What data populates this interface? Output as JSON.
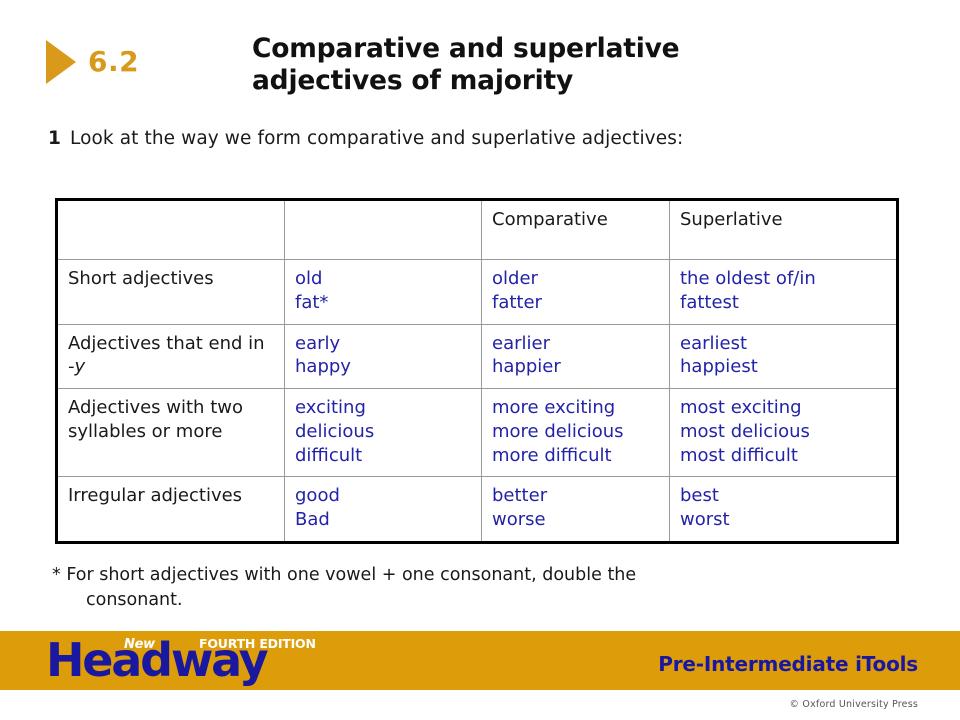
{
  "header": {
    "unit_number": "6.2",
    "title_line1": "Comparative and superlative",
    "title_line2": "adjectives of majority",
    "accent_color": "#D99A1C"
  },
  "instruction": {
    "number": "1",
    "text": "Look at the way we form comparative and superlative adjectives:"
  },
  "table": {
    "headers": [
      "",
      "",
      "Comparative",
      "Superlative"
    ],
    "rows": [
      {
        "category": "Short adjectives",
        "base": "old\nfat*",
        "comparative": "older\nfatter",
        "superlative": "the oldest of/in\nfattest"
      },
      {
        "category_pre": "Adjectives that end in ",
        "category_italic": "-y",
        "category": "Adjectives that end in -y",
        "base": "early\nhappy",
        "comparative": "earlier\nhappier",
        "superlative": "earliest\nhappiest"
      },
      {
        "category": "Adjectives with two syllables or more",
        "base": "exciting\ndelicious\ndifficult",
        "comparative": "more exciting\nmore delicious\nmore difficult",
        "superlative": "most exciting\nmost delicious\nmost difficult"
      },
      {
        "category": "Irregular adjectives",
        "base": "good\nBad",
        "comparative": "better\nworse",
        "superlative": "best\nworst"
      }
    ],
    "text_color": "#2323A8",
    "border_color": "#000000"
  },
  "footnote": {
    "line1": "* For short adjectives with one vowel + one consonant, double the",
    "line2": "consonant."
  },
  "footer": {
    "band_color": "#DD9D0B",
    "logo_new": "New",
    "logo_edition": "FOURTH EDITION",
    "logo_headway": "Headway",
    "product": "Pre-Intermediate iTools",
    "copyright": "© Oxford University Press",
    "logo_color": "#1A189E"
  }
}
